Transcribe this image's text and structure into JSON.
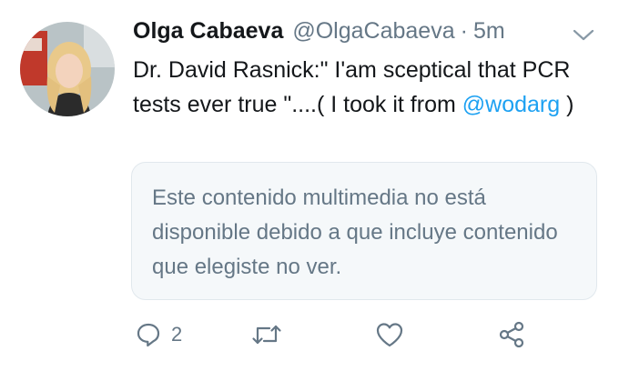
{
  "tweet": {
    "author_name": "Olga Cabaeva",
    "author_handle": "@OlgaCabaeva",
    "separator": "·",
    "timestamp": "5m",
    "text_part1": "Dr. David Rasnick:\" I'am sceptical that PCR tests ever true \"....( I took it from ",
    "mention": "@wodarg",
    "text_part2": " )",
    "media_notice": "Este contenido multimedia no está disponible debido a que incluye contenido que elegiste no ver.",
    "reply_count": "2"
  },
  "icons": {
    "reply": "reply-icon",
    "retweet": "retweet-icon",
    "like": "heart-icon",
    "share": "share-icon",
    "menu": "chevron-down-icon"
  },
  "colors": {
    "text": "#14171a",
    "muted": "#657786",
    "link": "#1da1f2",
    "card_bg": "#f5f8fa",
    "card_border": "#e1e8ed"
  }
}
